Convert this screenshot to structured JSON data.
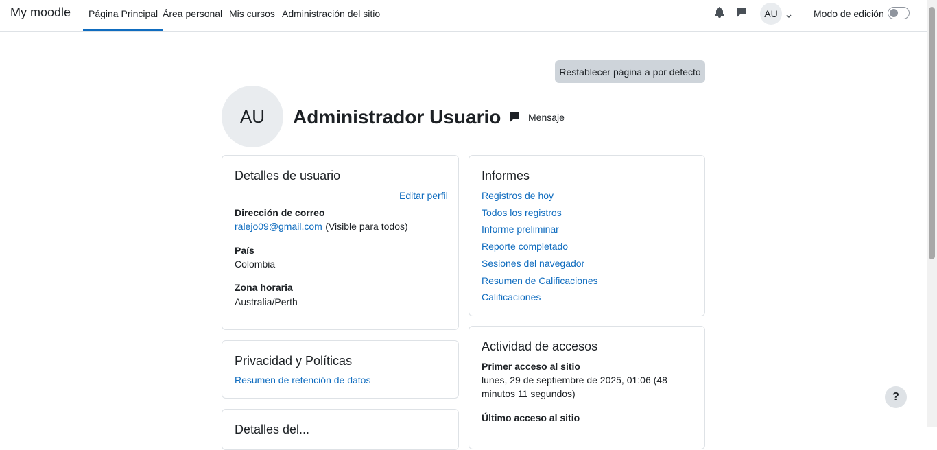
{
  "navbar": {
    "brand": "My moodle",
    "links": [
      {
        "label": "Página Principal",
        "active": true
      },
      {
        "label": "Área personal"
      },
      {
        "label": "Mis cursos"
      },
      {
        "label": "Administración del sitio"
      }
    ],
    "avatar_initials": "AU",
    "edit_mode_label": "Modo de edición",
    "edit_mode_on": false
  },
  "page": {
    "reset_button": "Restablecer página a por defecto",
    "avatar_initials": "AU",
    "user_name": "Administrador Usuario",
    "message_label": "Mensaje"
  },
  "user_details": {
    "title": "Detalles de usuario",
    "edit_profile": "Editar perfil",
    "email_label": "Dirección de correo",
    "email_value": "ralejo09@gmail.com",
    "email_visibility": "(Visible para todos)",
    "country_label": "País",
    "country_value": "Colombia",
    "timezone_label": "Zona horaria",
    "timezone_value": "Australia/Perth"
  },
  "privacy": {
    "title": "Privacidad y Políticas",
    "link": "Resumen de retención de datos"
  },
  "next_card": {
    "title": "Detalles del..."
  },
  "reports": {
    "title": "Informes",
    "links": [
      "Registros de hoy",
      "Todos los registros",
      "Informe preliminar",
      "Reporte completado",
      "Sesiones del navegador",
      "Resumen de Calificaciones",
      "Calificaciones"
    ]
  },
  "access": {
    "title": "Actividad de accesos",
    "first_label": "Primer acceso al sitio",
    "first_value_line1": "lunes, 29 de septiembre de 2025, 01:06  (48",
    "first_value_line2": "minutos 11 segundos)",
    "last_label": "Último acceso al sitio"
  },
  "help": {
    "label": "?"
  },
  "colors": {
    "link": "#0f6cbf",
    "button_bg": "#ced4da",
    "avatar_bg": "#e9ecef"
  },
  "icons": [
    "bell-icon",
    "chat-icon",
    "chevron-down-icon",
    "message-icon",
    "question-icon"
  ]
}
